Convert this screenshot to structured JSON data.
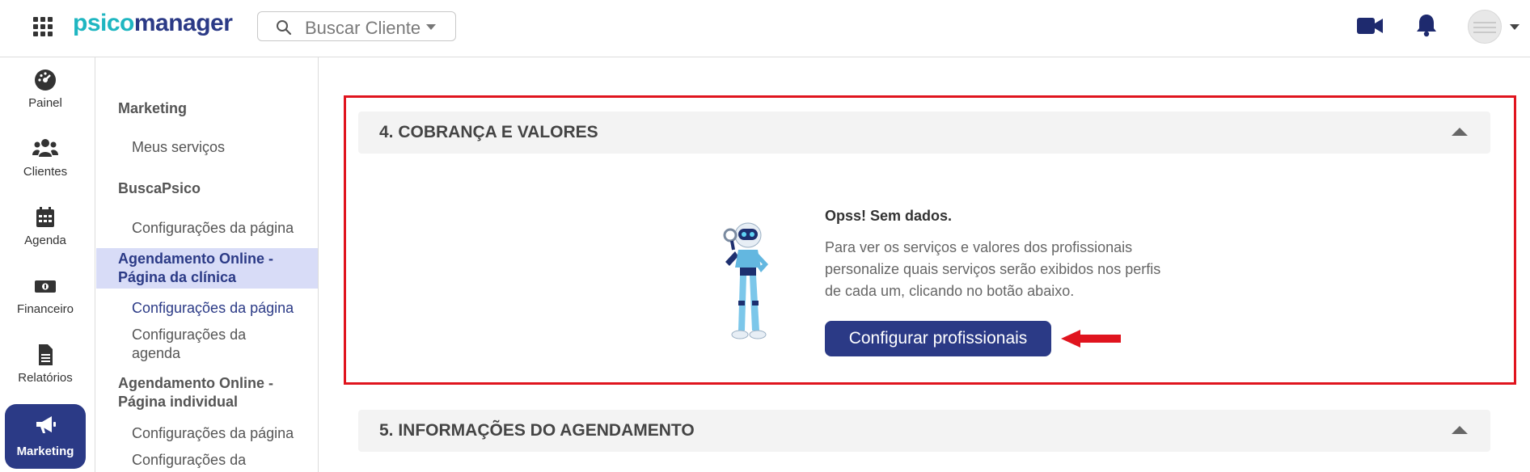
{
  "brand": {
    "logo_part1": "psico",
    "logo_part2": "manager",
    "accent": "#2b3a86",
    "teal": "#1fb6c1"
  },
  "header": {
    "search_placeholder": "Buscar Cliente",
    "icons": [
      "apps-grid-icon",
      "search-icon",
      "video-icon",
      "bell-icon",
      "avatar"
    ]
  },
  "iconnav": {
    "items": [
      {
        "label": "Painel",
        "icon": "dashboard-gauge-icon"
      },
      {
        "label": "Clientes",
        "icon": "users-icon"
      },
      {
        "label": "Agenda",
        "icon": "calendar-icon"
      },
      {
        "label": "Financeiro",
        "icon": "money-icon"
      },
      {
        "label": "Relatórios",
        "icon": "document-icon"
      },
      {
        "label": "Marketing",
        "icon": "megaphone-icon",
        "active": true
      }
    ]
  },
  "subnav": {
    "marketing": "Marketing",
    "meus_servicos": "Meus serviços",
    "buscapsico": "BuscaPsico",
    "buscapsico_config": "Configurações da página",
    "agendamento_clinica_l1": "Agendamento Online -",
    "agendamento_clinica_l2": "Página da clínica",
    "clinica_config_pagina": "Configurações da página",
    "clinica_config_agenda_l1": "Configurações da",
    "clinica_config_agenda_l2": "agenda",
    "agendamento_individual_l1": "Agendamento Online -",
    "agendamento_individual_l2": "Página individual",
    "individual_config_pagina": "Configurações da página",
    "individual_config_agenda_l1": "Configurações da"
  },
  "main": {
    "section4_title": "4. COBRANÇA E VALORES",
    "empty_title": "Opss! Sem dados.",
    "empty_text": "Para ver os serviços e valores dos profissionais personalize quais serviços serão exibidos nos perfis de cada um, clicando no botão abaixo.",
    "button_label": "Configurar profissionais",
    "section5_title": "5. INFORMAÇÕES DO AGENDAMENTO",
    "highlight_color": "#e0141e"
  }
}
